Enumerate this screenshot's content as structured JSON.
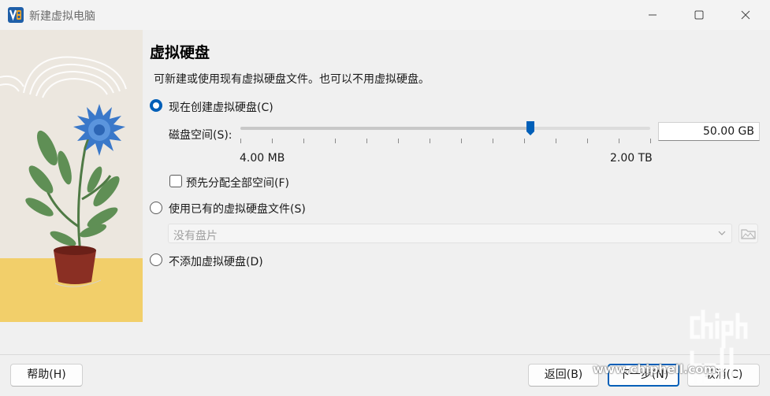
{
  "window": {
    "title": "新建虚拟电脑",
    "controls": [
      "minimize-icon",
      "maximize-icon",
      "close-icon"
    ]
  },
  "page": {
    "heading": "虚拟硬盘",
    "description": "可新建或使用现有虚拟硬盘文件。也可以不用虚拟硬盘。"
  },
  "options": {
    "create_new": {
      "label": "现在创建虚拟硬盘(C)",
      "checked": true
    },
    "use_existing": {
      "label": "使用已有的虚拟硬盘文件(S)",
      "checked": false
    },
    "no_disk": {
      "label": "不添加虚拟硬盘(D)",
      "checked": false
    }
  },
  "disk_size": {
    "label": "磁盘空间(S):",
    "value": "50.00 GB",
    "min_label": "4.00 MB",
    "max_label": "2.00 TB",
    "slider_fraction": 0.7
  },
  "preallocate": {
    "label": "预先分配全部空间(F)",
    "checked": false
  },
  "existing_disk": {
    "selected": "没有盘片"
  },
  "buttons": {
    "help": "帮助(H)",
    "back": "返回(B)",
    "next": "下一步(N)",
    "cancel": "取消(C)"
  },
  "watermark": {
    "url": "www.chiphell.com"
  },
  "colors": {
    "accent": "#005fb8",
    "background": "#f0f0f0"
  }
}
